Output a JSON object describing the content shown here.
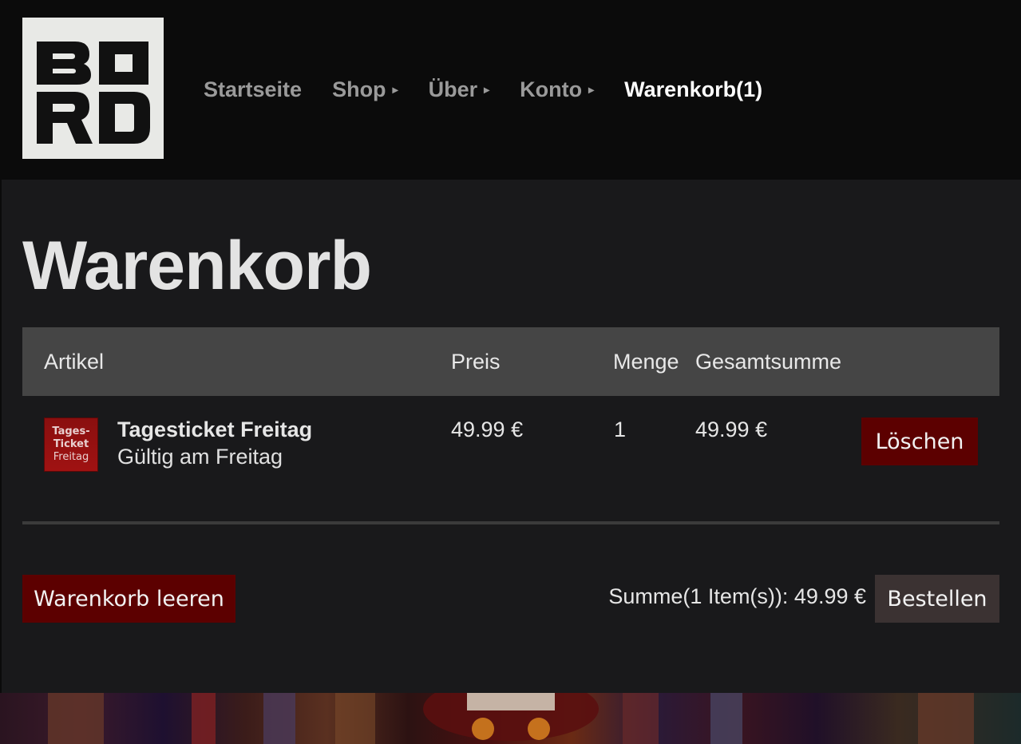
{
  "logo": {
    "text": "BORD"
  },
  "nav": {
    "items": [
      {
        "label": "Startseite",
        "has_arrow": false,
        "active": false
      },
      {
        "label": "Shop",
        "has_arrow": true,
        "active": false
      },
      {
        "label": "Über",
        "has_arrow": true,
        "active": false
      },
      {
        "label": "Konto",
        "has_arrow": true,
        "active": false
      },
      {
        "label": "Warenkorb(1)",
        "has_arrow": false,
        "active": true
      }
    ],
    "arrow_glyph": "▸"
  },
  "page": {
    "title": "Warenkorb"
  },
  "table": {
    "headers": {
      "article": "Artikel",
      "price": "Preis",
      "quantity": "Menge",
      "total": "Gesamtsumme"
    },
    "rows": [
      {
        "thumb_lines": [
          "Tages-",
          "Ticket",
          "Freitag"
        ],
        "name": "Tagesticket Freitag",
        "description": "Gültig am Freitag",
        "price": "49.99 €",
        "quantity": "1",
        "total": "49.99 €",
        "delete_label": "Löschen"
      }
    ]
  },
  "footer": {
    "clear_label": "Warenkorb leeren",
    "sum_text": "Summe(1 Item(s)): 49.99 €",
    "order_label": "Bestellen"
  },
  "colors": {
    "header_bg": "#0b0b0b",
    "page_bg": "#19191b",
    "table_head_bg": "#454545",
    "danger_button": "#5c0000",
    "order_button": "#3b3232"
  }
}
